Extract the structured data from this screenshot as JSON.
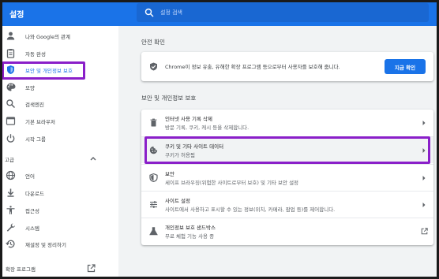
{
  "app": {
    "title": "설정"
  },
  "search": {
    "placeholder": "설정 검색"
  },
  "sidebar": {
    "items": [
      {
        "label": "나와 Google의 관계",
        "icon": "person-icon"
      },
      {
        "label": "자동 완성",
        "icon": "clipboard-icon"
      },
      {
        "label": "보안 및 개인정보 보호",
        "icon": "shield-icon"
      },
      {
        "label": "모양",
        "icon": "palette-icon"
      },
      {
        "label": "검색엔진",
        "icon": "search-icon"
      },
      {
        "label": "기본 브라우저",
        "icon": "browser-icon"
      },
      {
        "label": "시작 그룹",
        "icon": "power-icon"
      }
    ],
    "advanced_label": "고급",
    "advanced_items": [
      {
        "label": "언어",
        "icon": "globe-icon"
      },
      {
        "label": "다운로드",
        "icon": "download-icon"
      },
      {
        "label": "접근성",
        "icon": "accessibility-icon"
      },
      {
        "label": "시스템",
        "icon": "wrench-icon"
      },
      {
        "label": "재설정 및 정리하기",
        "icon": "history-icon"
      }
    ],
    "extensions_label": "확장 프로그램"
  },
  "safety_check": {
    "heading": "안전 확인",
    "text": "Chrome이 정보 유출, 유해한 확장 프로그램 등으로부터 사용자를 보호해 줍니다.",
    "button": "지금 확인"
  },
  "privacy": {
    "heading": "보안 및 개인정보 보호",
    "rows": [
      {
        "title": "인터넷 사용 기록 삭제",
        "subtitle": "방문 기록, 쿠키, 캐시 등을 삭제합니다.",
        "icon": "trash-icon"
      },
      {
        "title": "쿠키 및 기타 사이트 데이터",
        "subtitle": "쿠키가 허용됨",
        "icon": "cookie-icon"
      },
      {
        "title": "보안",
        "subtitle": "세이프 브라우징(위험한 사이트로부터 보호) 및 기타 보안 설정",
        "icon": "shield-icon"
      },
      {
        "title": "사이트 설정",
        "subtitle": "사이트에서 사용하고 표시할 수 있는 정보(위치, 카메라, 팝업 등)를 제어합니다.",
        "icon": "sliders-icon"
      },
      {
        "title": "개인정보 보호 샌드박스",
        "subtitle": "무료 체험 기능 사용 중",
        "icon": "flask-icon"
      }
    ]
  },
  "colors": {
    "accent": "#1a73e8",
    "highlight": "#8a1fc9"
  }
}
